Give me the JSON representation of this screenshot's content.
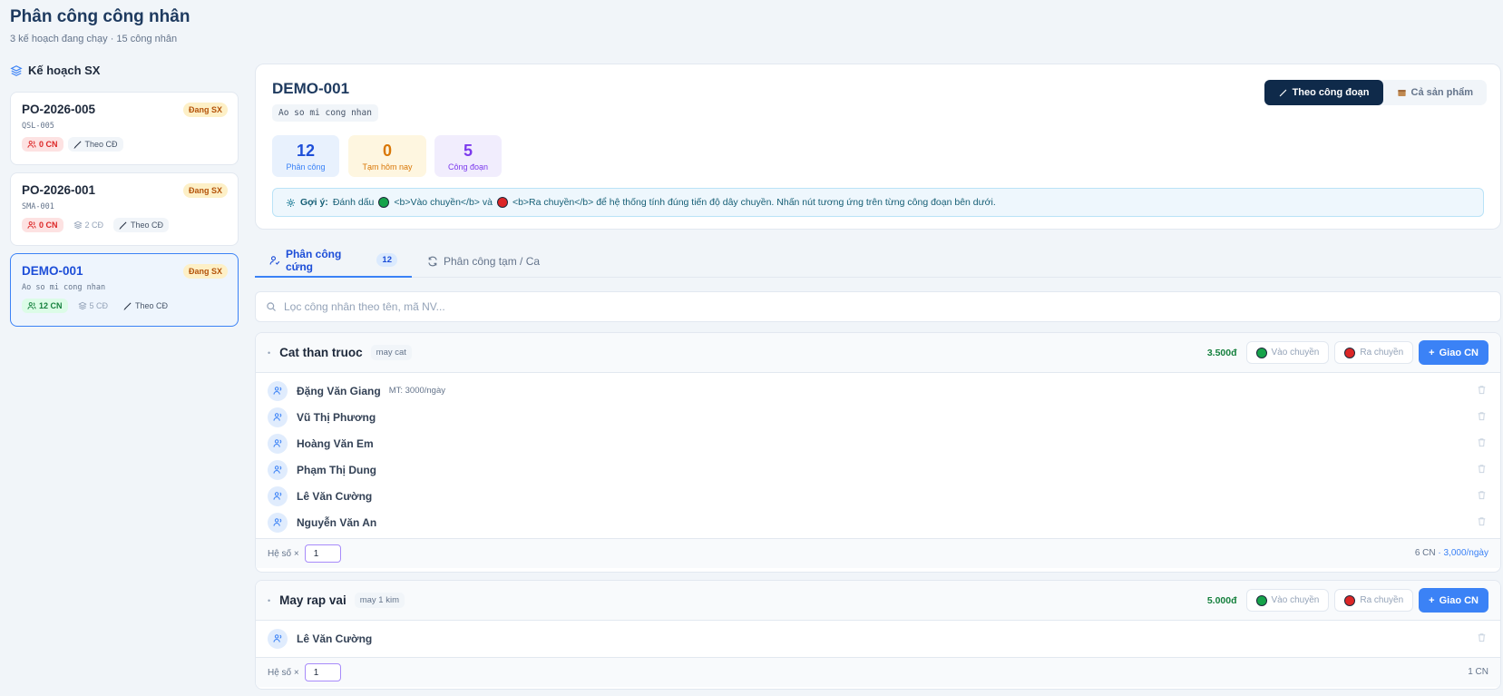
{
  "header": {
    "title": "Phân công công nhân",
    "subtitle": "3 kế hoạch đang chạy · 15 công nhân"
  },
  "sidebar": {
    "title": "Kế hoạch SX",
    "plans": [
      {
        "code": "PO-2026-005",
        "sub": "QSL-005",
        "status": "Đang SX",
        "workers": "0 CN",
        "stages": "",
        "mode": "Theo CĐ"
      },
      {
        "code": "PO-2026-001",
        "sub": "SMA-001",
        "status": "Đang SX",
        "workers": "0 CN",
        "stages": "2 CĐ",
        "mode": "Theo CĐ"
      },
      {
        "code": "DEMO-001",
        "sub": "Ao so mi cong nhan",
        "status": "Đang SX",
        "workers": "12 CN",
        "stages": "5 CĐ",
        "mode": "Theo CĐ"
      }
    ]
  },
  "detail": {
    "title": "DEMO-001",
    "tag": "Ao so mi cong nhan",
    "stats": [
      {
        "value": "12",
        "label": "Phân công"
      },
      {
        "value": "0",
        "label": "Tạm hôm nay"
      },
      {
        "value": "5",
        "label": "Công đoạn"
      }
    ],
    "view_stage": "Theo công đoạn",
    "view_product": "Cả sản phẩm",
    "hint_label": "Gợi ý:",
    "hint_text_1": "Đánh dấu",
    "hint_text_2": "<b>Vào chuyền</b> và",
    "hint_text_3": "<b>Ra chuyền</b> để hệ thống tính đúng tiến độ dây chuyền. Nhấn nút tương ứng trên từng công đoạn bên dưới."
  },
  "tabs": {
    "fixed_label": "Phân công cứng",
    "fixed_count": "12",
    "temp_label": "Phân công tạm / Ca"
  },
  "search": {
    "placeholder": "Lọc công nhân theo tên, mã NV..."
  },
  "buttons": {
    "enter_line": "Vào chuyền",
    "exit_line": "Ra chuyền",
    "assign": "Giao CN"
  },
  "groups": [
    {
      "name": "Cat than truoc",
      "tag": "may cat",
      "price": "3.500đ",
      "workers": [
        {
          "name": "Đặng Văn Giang",
          "target": "MT: 3000/ngày"
        },
        {
          "name": "Vũ Thị Phương",
          "target": ""
        },
        {
          "name": "Hoàng Văn Em",
          "target": ""
        },
        {
          "name": "Phạm Thị Dung",
          "target": ""
        },
        {
          "name": "Lê Văn Cường",
          "target": ""
        },
        {
          "name": "Nguyễn Văn An",
          "target": ""
        }
      ],
      "coef_label": "Hệ số ×",
      "coef_value": "1",
      "count": "6 CN",
      "rate": "· 3,000/ngày"
    },
    {
      "name": "May rap vai",
      "tag": "may 1 kim",
      "price": "5.000đ",
      "workers": [
        {
          "name": "Lê Văn Cường",
          "target": ""
        }
      ],
      "coef_label": "Hệ số ×",
      "coef_value": "1",
      "count": "1 CN",
      "rate": ""
    }
  ]
}
